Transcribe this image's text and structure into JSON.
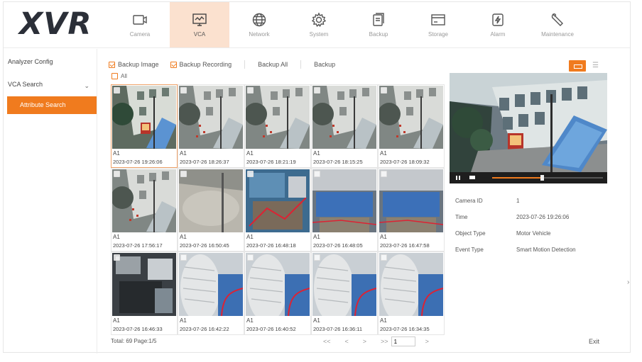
{
  "app": {
    "logo": "XVR"
  },
  "nav": [
    {
      "label": "Camera",
      "icon": "camera-icon",
      "active": false
    },
    {
      "label": "VCA",
      "icon": "vca-monitor-icon",
      "active": true
    },
    {
      "label": "Network",
      "icon": "network-globe-icon",
      "active": false
    },
    {
      "label": "System",
      "icon": "system-gear-icon",
      "active": false
    },
    {
      "label": "Backup",
      "icon": "backup-document-icon",
      "active": false
    },
    {
      "label": "Storage",
      "icon": "storage-icon",
      "active": false
    },
    {
      "label": "Alarm",
      "icon": "alarm-bolt-icon",
      "active": false
    },
    {
      "label": "Maintenance",
      "icon": "maintenance-wrench-icon",
      "active": false
    }
  ],
  "sidebar": {
    "items": [
      "Analyzer Config",
      "VCA Search"
    ],
    "active_item": "Attribute Search"
  },
  "toolbar": {
    "backup_image": "Backup Image",
    "backup_recording": "Backup Recording",
    "backup_all": "Backup All",
    "backup": "Backup",
    "all": "All"
  },
  "results": [
    {
      "channel": "A1",
      "time": "2023-07-26 19:26:06",
      "scene": "building",
      "selected": true
    },
    {
      "channel": "A1",
      "time": "2023-07-26 18:26:37",
      "scene": "building-gray",
      "selected": false
    },
    {
      "channel": "A1",
      "time": "2023-07-26 18:21:19",
      "scene": "building-gray",
      "selected": false
    },
    {
      "channel": "A1",
      "time": "2023-07-26 18:15:25",
      "scene": "building-gray",
      "selected": false
    },
    {
      "channel": "A1",
      "time": "2023-07-26 18:09:32",
      "scene": "building-gray",
      "selected": false
    },
    {
      "channel": "A1",
      "time": "2023-07-26 17:56:17",
      "scene": "building-gray",
      "selected": false
    },
    {
      "channel": "A1",
      "time": "2023-07-26 16:50:45",
      "scene": "floor",
      "selected": false
    },
    {
      "channel": "A1",
      "time": "2023-07-26 16:48:18",
      "scene": "office-blue",
      "selected": false
    },
    {
      "channel": "A1",
      "time": "2023-07-26 16:48:05",
      "scene": "office-table",
      "selected": false
    },
    {
      "channel": "A1",
      "time": "2023-07-26 16:47:58",
      "scene": "office-table",
      "selected": false
    },
    {
      "channel": "A1",
      "time": "2023-07-26 16:46:33",
      "scene": "office-dark",
      "selected": false
    },
    {
      "channel": "A1",
      "time": "2023-07-26 16:42:22",
      "scene": "closeup",
      "selected": false
    },
    {
      "channel": "A1",
      "time": "2023-07-26 16:40:52",
      "scene": "closeup",
      "selected": false
    },
    {
      "channel": "A1",
      "time": "2023-07-26 16:36:11",
      "scene": "closeup",
      "selected": false
    },
    {
      "channel": "A1",
      "time": "2023-07-26 16:34:35",
      "scene": "closeup",
      "selected": false
    }
  ],
  "pagination": {
    "summary": "Total: 69  Page:1/5",
    "first": "<<",
    "prev": "<",
    "next": ">",
    "last": ">>",
    "page_input": "1",
    "go": ">"
  },
  "player": {
    "progress": 0.45
  },
  "details": [
    {
      "label": "Camera ID",
      "value": "1"
    },
    {
      "label": "Time",
      "value": "2023-07-26 19:26:06"
    },
    {
      "label": "Object Type",
      "value": "Motor Vehicle"
    },
    {
      "label": "Event Type",
      "value": "Smart Motion Detection"
    }
  ],
  "exit": "Exit",
  "colors": {
    "accent": "#f07b1e",
    "active_tab": "#fbe1cf"
  }
}
